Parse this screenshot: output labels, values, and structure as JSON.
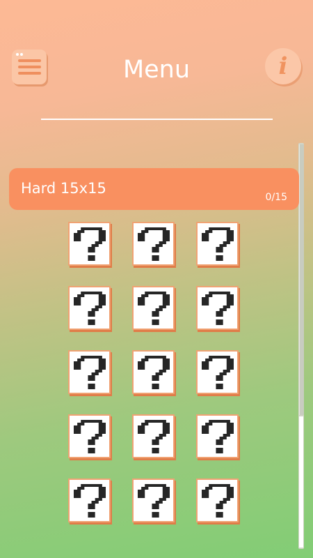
{
  "header": {
    "title": "Menu",
    "menu_icon": "hamburger-icon",
    "info_icon": "info-icon",
    "info_glyph": "i"
  },
  "level_pack": {
    "name": "Hard 15x15",
    "progress": "0/15"
  },
  "puzzles": {
    "count": 15,
    "locked_icon": "question-mark-icon"
  },
  "colors": {
    "accent": "#f99060",
    "tile_border": "#f0a273",
    "glyph": "#262626"
  }
}
